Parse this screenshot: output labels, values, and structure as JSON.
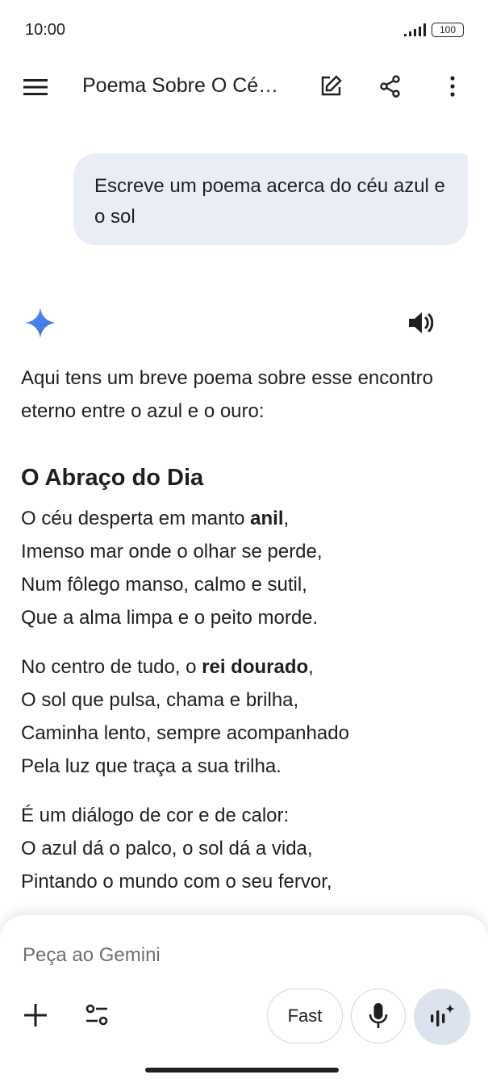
{
  "status_bar": {
    "time": "10:00",
    "battery": "100"
  },
  "app_bar": {
    "title": "Poema Sobre O Cé…",
    "icons": [
      "menu-icon",
      "edit-icon",
      "share-icon",
      "more-vert-icon"
    ]
  },
  "user_message": {
    "text": "Escreve um poema acerca do céu azul e o sol"
  },
  "response": {
    "intro": "Aqui tens um breve poema sobre esse encontro eterno entre o azul e o ouro:",
    "poem_title": "O Abraço do Dia",
    "stanza1": {
      "l1_a": "O céu desperta em manto ",
      "l1_b": "anil",
      "l1_c": ",",
      "l2": "Imenso mar onde o olhar se perde,",
      "l3": "Num fôlego manso, calmo e sutil,",
      "l4": "Que a alma limpa e o peito morde."
    },
    "stanza2": {
      "l1_a": "No centro de tudo, o ",
      "l1_b": "rei dourado",
      "l1_c": ",",
      "l2": "O sol que pulsa, chama e brilha,",
      "l3": "Caminha lento, sempre acompanhado",
      "l4": "Pela luz que traça a sua trilha."
    },
    "stanza3": {
      "l1": "É um diálogo de cor e de calor:",
      "l2": "O azul dá o palco, o sol dá a vida,",
      "l3": "Pintando o mundo com o seu fervor,"
    }
  },
  "input": {
    "placeholder": "Peça ao Gemini",
    "mode_label": "Fast"
  },
  "colors": {
    "bubble": "#e9eef6",
    "accent_blue": "#4285f4",
    "live_button": "#dde3ee"
  }
}
